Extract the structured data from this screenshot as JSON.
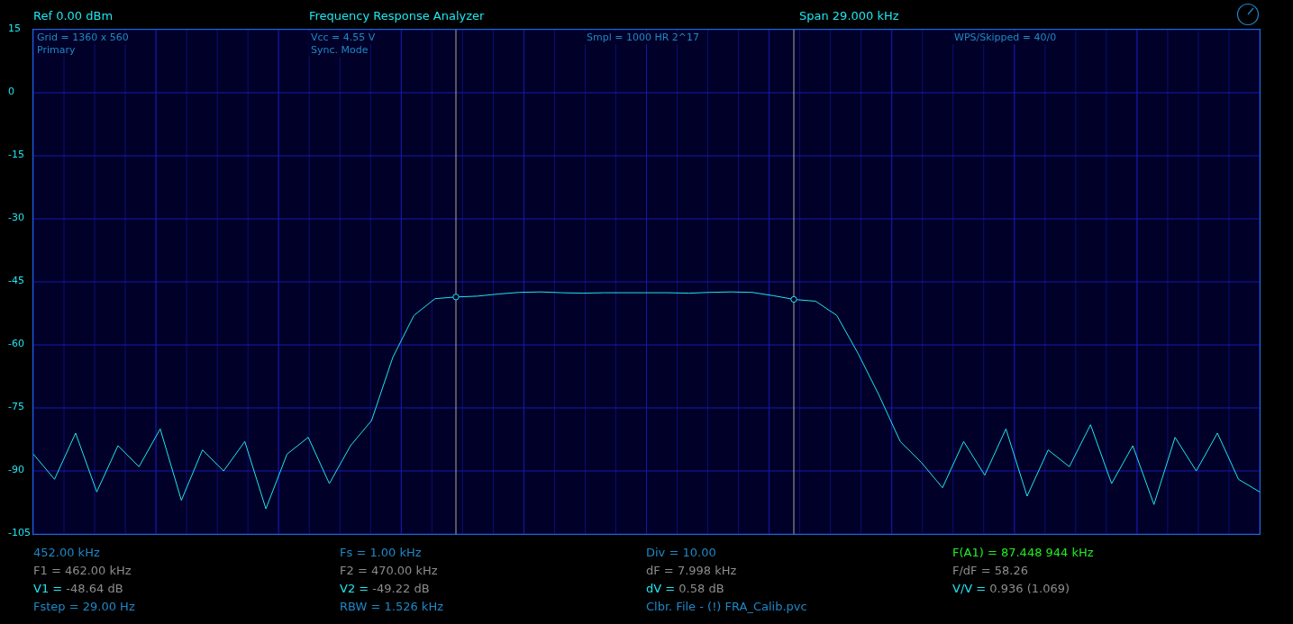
{
  "header": {
    "reference": "Ref  0.00 dBm",
    "title": "Frequency Response Analyzer",
    "span": "Span 29.000 kHz"
  },
  "plot": {
    "overlay": [
      {
        "lines": [
          "Grid = 1360 x 560",
          "Primary"
        ]
      },
      {
        "lines": [
          "Vcc = 4.55 V",
          "Sync. Mode"
        ]
      },
      {
        "lines": [
          "Smpl = 1000 HR 2^17"
        ]
      },
      {
        "lines": [
          "WPS/Skipped  = 40/0"
        ]
      }
    ],
    "chart_data": {
      "type": "line",
      "grid": true,
      "ylim": [
        -105,
        15
      ],
      "yticks": [
        {
          "value": 15,
          "label": "15"
        },
        {
          "value": 0,
          "label": "0"
        },
        {
          "value": -15,
          "label": "-15"
        },
        {
          "value": -30,
          "label": "-30"
        },
        {
          "value": -45,
          "label": "-45"
        },
        {
          "value": -60,
          "label": "-60"
        },
        {
          "value": -75,
          "label": "-75"
        },
        {
          "value": -90,
          "label": "-90"
        },
        {
          "value": -105,
          "label": "-105"
        }
      ],
      "categories": [
        null,
        null,
        null,
        null,
        null,
        null,
        null,
        null,
        null,
        null,
        null,
        null,
        null,
        null,
        null,
        null,
        null,
        null,
        null,
        null,
        null,
        null,
        null,
        null,
        null,
        null,
        null,
        null,
        null,
        null,
        null,
        null,
        null,
        null,
        null,
        null,
        null,
        null,
        null,
        null,
        null,
        null,
        null,
        null,
        null,
        null,
        null,
        null,
        null,
        null,
        null,
        null,
        null,
        null,
        null,
        null,
        null,
        null,
        null
      ],
      "series": [
        {
          "color": "#1ee6f0",
          "values": [
            -86,
            -92,
            -81,
            -95,
            -84,
            -89,
            -80,
            -97,
            -85,
            -90,
            -83,
            -99,
            -86,
            -82,
            -93,
            -84,
            -78,
            -63,
            -53,
            -49,
            -48.6,
            -48.4,
            -47.9,
            -47.5,
            -47.4,
            -47.6,
            -47.7,
            -47.6,
            -47.6,
            -47.6,
            -47.6,
            -47.7,
            -47.5,
            -47.4,
            -47.5,
            -48.3,
            -49.2,
            -49.6,
            -53,
            -62,
            -72,
            -83,
            -88,
            -94,
            -83,
            -91,
            -80,
            -96,
            -85,
            -89,
            -79,
            -93,
            -84,
            -98,
            -82,
            -90,
            -81,
            -92,
            -95
          ]
        }
      ]
    }
  },
  "readouts": [
    [
      {
        "kind": "setting",
        "text": "452.00 kHz"
      },
      {
        "kind": "measure",
        "text": "F1 = 462.00 kHz"
      },
      {
        "kind": "cursor",
        "label": "V1 =",
        "value": "-48.64 dB"
      },
      {
        "kind": "setting",
        "text": "Fstep = 29.00 Hz"
      }
    ],
    [
      {
        "kind": "setting",
        "text": "Fs = 1.00 kHz"
      },
      {
        "kind": "measure",
        "text": "F2 = 470.00 kHz"
      },
      {
        "kind": "cursor",
        "label": "V2 =",
        "value": "-49.22 dB"
      },
      {
        "kind": "setting",
        "text": "RBW = 1.526 kHz"
      }
    ],
    [
      {
        "kind": "setting",
        "text": "Div = 10.00"
      },
      {
        "kind": "measure",
        "text": "dF = 7.998 kHz"
      },
      {
        "kind": "cursor",
        "label": "dV =",
        "value": "0.58 dB"
      },
      {
        "kind": "setting",
        "text": "Clbr. File - (!) FRA_Calib.pvc"
      }
    ],
    [
      {
        "kind": "frequency",
        "text": "F(A1) = 87.448 944 kHz"
      },
      {
        "kind": "measure",
        "text": "F/dF = 58.26"
      },
      {
        "kind": "cursor",
        "label": "V/V =",
        "value": "0.936 (1.069)"
      }
    ]
  ]
}
